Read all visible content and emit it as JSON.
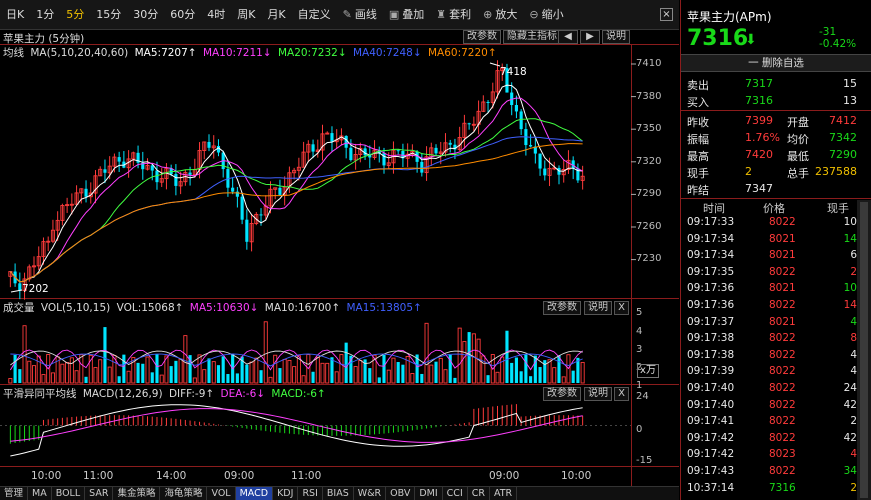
{
  "toolbar": {
    "items": [
      {
        "label": "日K",
        "icon": ""
      },
      {
        "label": "1分",
        "icon": ""
      },
      {
        "label": "5分",
        "icon": "",
        "active": true
      },
      {
        "label": "15分",
        "icon": ""
      },
      {
        "label": "30分",
        "icon": ""
      },
      {
        "label": "60分",
        "icon": ""
      },
      {
        "label": "4时",
        "icon": ""
      },
      {
        "label": "周K",
        "icon": ""
      },
      {
        "label": "月K",
        "icon": ""
      },
      {
        "label": "自定义",
        "icon": ""
      },
      {
        "label": "画线",
        "icon": "✎"
      },
      {
        "label": "叠加",
        "icon": "▣"
      },
      {
        "label": "套利",
        "icon": "♜"
      },
      {
        "label": "放大",
        "icon": "⊕"
      },
      {
        "label": "缩小",
        "icon": "⊖"
      }
    ],
    "close": "×"
  },
  "main_panel": {
    "name": "苹果主力 (5分钟)",
    "ma_title": "均线",
    "ma_params": "MA(5,10,20,40,60)",
    "ma5": "MA5:7207↑",
    "ma10": "MA10:7211↓",
    "ma20": "MA20:7232↓",
    "ma40": "MA40:7248↓",
    "ma60": "MA60:7220↑",
    "btn_params": "改参数",
    "btn_hide": "隐藏主指标",
    "btn_prev": "◀",
    "btn_next": "▶",
    "btn_help": "说明",
    "high_label": "7418",
    "low_label": "7202",
    "y_ticks": [
      "7410",
      "7380",
      "7350",
      "7320",
      "7290",
      "7260",
      "7230"
    ]
  },
  "vol_panel": {
    "title": "成交量",
    "params": "VOL(5,10,15)",
    "vol": "VOL:15068↑",
    "ma5": "MA5:10630↓",
    "ma10": "MA10:16700↑",
    "ma15": "MA15:13805↑",
    "btn_params": "改参数",
    "btn_help": "说明",
    "btn_close": "X",
    "y_ticks": [
      "5",
      "4",
      "3",
      "2",
      "1"
    ],
    "unit": "x万"
  },
  "macd_panel": {
    "title": "平滑异同平均线",
    "params": "MACD(12,26,9)",
    "diff": "DIFF:-9↑",
    "dea": "DEA:-6↓",
    "macd": "MACD:-6↑",
    "btn_params": "改参数",
    "btn_help": "说明",
    "btn_close": "X",
    "y_ticks": [
      "24",
      "0",
      "-15"
    ]
  },
  "x_ticks": [
    "10:00",
    "11:00",
    "14:00",
    "09:00",
    "11:00",
    "09:00",
    "10:00"
  ],
  "bottom_tabs": [
    "管理",
    "MA",
    "BOLL",
    "SAR",
    "集金策略",
    "海龟策略",
    "VOL",
    "MACD",
    "KDJ",
    "RSI",
    "BIAS",
    "W&R",
    "OBV",
    "DMI",
    "CCI",
    "CR",
    "ATR"
  ],
  "quote": {
    "name": "苹果主力(APm)",
    "price": "7316",
    "arrow": "⬇",
    "change": "-31",
    "change_pct": "-0.42%",
    "watchlist_btn": "一 删除自选",
    "sell_label": "卖出",
    "sell_price": "7317",
    "sell_vol": "15",
    "buy_label": "买入",
    "buy_price": "7316",
    "buy_vol": "13",
    "stats": [
      {
        "l1": "昨收",
        "v1": "7399",
        "c1": "red",
        "l2": "开盘",
        "v2": "7412",
        "c2": "red"
      },
      {
        "l1": "振幅",
        "v1": "1.76%",
        "c1": "red",
        "l2": "均价",
        "v2": "7342",
        "c2": "green"
      },
      {
        "l1": "最高",
        "v1": "7420",
        "c1": "red",
        "l2": "最低",
        "v2": "7290",
        "c2": "green"
      },
      {
        "l1": "现手",
        "v1": "2",
        "c1": "yellow",
        "l2": "总手",
        "v2": "237588",
        "c2": "yellow"
      }
    ],
    "settle_label": "昨结",
    "settle_value": "7347"
  },
  "ticks_header": {
    "time": "时间",
    "price": "价格",
    "vol": "现手"
  },
  "ticks": [
    {
      "t": "09:17:33",
      "p": "8022",
      "pc": "red",
      "v": "10",
      "vc": "white"
    },
    {
      "t": "09:17:34",
      "p": "8021",
      "pc": "red",
      "v": "14",
      "vc": "green"
    },
    {
      "t": "09:17:34",
      "p": "8021",
      "pc": "red",
      "v": "6",
      "vc": "white"
    },
    {
      "t": "09:17:35",
      "p": "8022",
      "pc": "red",
      "v": "2",
      "vc": "red"
    },
    {
      "t": "09:17:36",
      "p": "8021",
      "pc": "red",
      "v": "10",
      "vc": "green"
    },
    {
      "t": "09:17:36",
      "p": "8022",
      "pc": "red",
      "v": "14",
      "vc": "red"
    },
    {
      "t": "09:17:37",
      "p": "8021",
      "pc": "red",
      "v": "4",
      "vc": "green"
    },
    {
      "t": "09:17:38",
      "p": "8022",
      "pc": "red",
      "v": "8",
      "vc": "red"
    },
    {
      "t": "09:17:38",
      "p": "8022",
      "pc": "red",
      "v": "4",
      "vc": "white"
    },
    {
      "t": "09:17:39",
      "p": "8022",
      "pc": "red",
      "v": "4",
      "vc": "white"
    },
    {
      "t": "09:17:40",
      "p": "8022",
      "pc": "red",
      "v": "24",
      "vc": "white"
    },
    {
      "t": "09:17:40",
      "p": "8022",
      "pc": "red",
      "v": "42",
      "vc": "white"
    },
    {
      "t": "09:17:41",
      "p": "8022",
      "pc": "red",
      "v": "2",
      "vc": "white"
    },
    {
      "t": "09:17:42",
      "p": "8022",
      "pc": "red",
      "v": "42",
      "vc": "white"
    },
    {
      "t": "09:17:42",
      "p": "8023",
      "pc": "red",
      "v": "4",
      "vc": "red"
    },
    {
      "t": "09:17:43",
      "p": "8022",
      "pc": "red",
      "v": "34",
      "vc": "green"
    },
    {
      "t": "10:37:14",
      "p": "7316",
      "pc": "green",
      "v": "2",
      "vc": "yellow"
    }
  ],
  "colors": {
    "up": "#ff3b3b",
    "down": "#00e5ff",
    "ma5": "#ffffff",
    "ma10": "#ff40ff",
    "ma20": "#40ff40",
    "ma40": "#4060ff",
    "ma60": "#ff8c00",
    "grid": "#8b1c1c"
  }
}
